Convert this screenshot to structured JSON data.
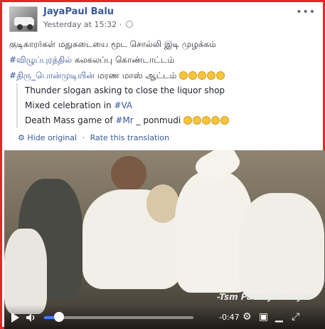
{
  "post": {
    "author": "JayaPaul Balu",
    "timestamp": "Yesterday at 15:32",
    "more_icon": "ellipsis-icon"
  },
  "content": {
    "line1": "குடிகாரர்கள் மதுகடையை மூட சொல்லி இடி முழக்கம்",
    "line2_hashtag": "#விழுப்புரத்தில்",
    "line2_rest": " கலகலப்பு கொண்டாட்டம்",
    "line3_hashtag": "#திரு_பொன்முடியின்",
    "line3_rest": " மரண மாஸ் ஆட்டம்",
    "emoji_count": 5
  },
  "translation": {
    "line1": "Thunder slogan asking to close the liquor shop",
    "line2_prefix": "Mixed celebration in ",
    "line2_hashtag": "#VA",
    "line3_prefix": "Death Mass game of ",
    "line3_hashtag": "#Mr",
    "line3_rest": " _ ponmudi",
    "hide_label": "Hide original",
    "rate_label": "Rate this translation",
    "separator": "·"
  },
  "video": {
    "watermark": "-Tsm Padaiyatchiyar",
    "time_remaining": "-0:47",
    "progress": 0.1
  },
  "colors": {
    "frame": "#e8242a",
    "link": "#385898",
    "progress": "#4080ff"
  }
}
